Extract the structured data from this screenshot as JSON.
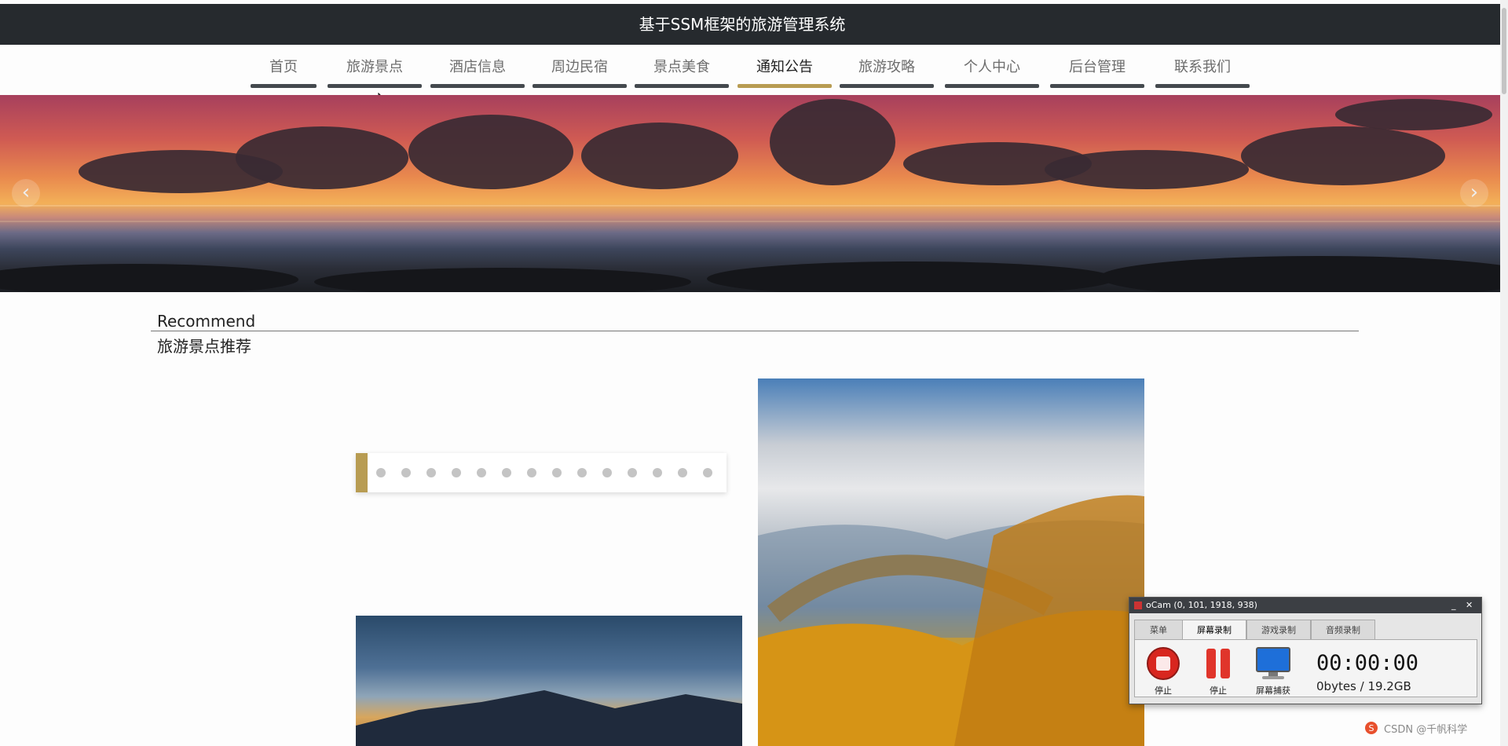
{
  "site": {
    "title": "基于SSM框架的旅游管理系统"
  },
  "nav": {
    "items": [
      {
        "label": "首页",
        "active": false
      },
      {
        "label": "旅游景点",
        "active": false
      },
      {
        "label": "酒店信息",
        "active": false
      },
      {
        "label": "周边民宿",
        "active": false
      },
      {
        "label": "景点美食",
        "active": false
      },
      {
        "label": "通知公告",
        "active": true
      },
      {
        "label": "旅游攻略",
        "active": false
      },
      {
        "label": "个人中心",
        "active": false
      },
      {
        "label": "后台管理",
        "active": false
      },
      {
        "label": "联系我们",
        "active": false
      }
    ]
  },
  "banner": {
    "prev_icon": "‹",
    "next_icon": "›"
  },
  "recommend": {
    "title_en": "Recommend",
    "title_cn": "旅游景点推荐",
    "dot_count": 14,
    "active_dot": 0
  },
  "ocam": {
    "title": "oCam (0, 101, 1918, 938)",
    "tabs": [
      "菜单",
      "屏幕录制",
      "游戏录制",
      "音频录制"
    ],
    "active_tab": 1,
    "buttons": {
      "stop": "停止",
      "pause": "停止",
      "capture": "屏幕捕获"
    },
    "time": "00:00:00",
    "size": "0bytes / 19.2GB",
    "minimize": "_",
    "close": "✕"
  },
  "watermark": "CSDN @千帆科学",
  "colors": {
    "accent": "#b89c52",
    "header_bg": "#262a2e",
    "nav_bar": "#44494e"
  }
}
